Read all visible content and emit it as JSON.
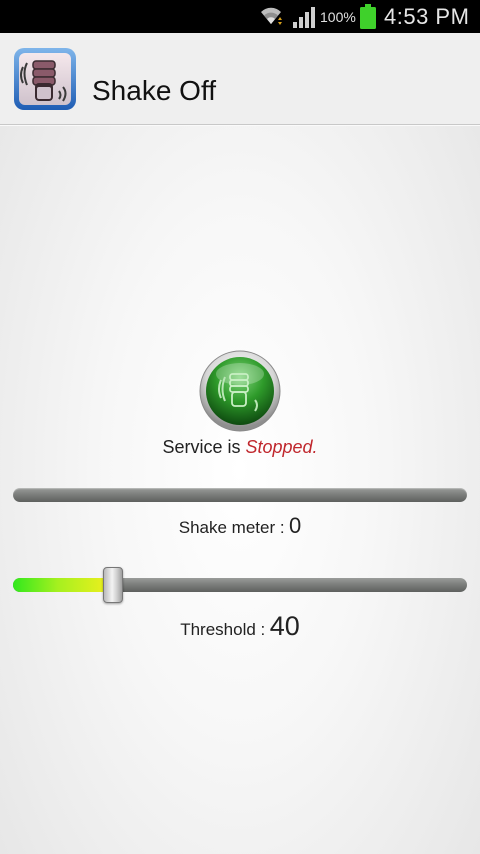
{
  "status_bar": {
    "battery_percent": "100%",
    "time": "4:53 PM",
    "icons": [
      "wifi-icon",
      "signal-icon",
      "battery-icon"
    ]
  },
  "app": {
    "title": "Shake Off",
    "icon": "shake-hand-app-icon"
  },
  "service": {
    "prefix": "Service is",
    "state": "Stopped.",
    "button_icon": "shake-hand-power-icon",
    "state_color": "#c0272d"
  },
  "shake_meter": {
    "label": "Shake meter :",
    "value": "0",
    "level_fraction": 0
  },
  "threshold": {
    "label": "Threshold :",
    "value": "40",
    "level_fraction": 0.22
  },
  "colors": {
    "accent_green": "#2e9a2a",
    "fill_start": "#31e81d",
    "fill_end": "#f4ef1e"
  }
}
